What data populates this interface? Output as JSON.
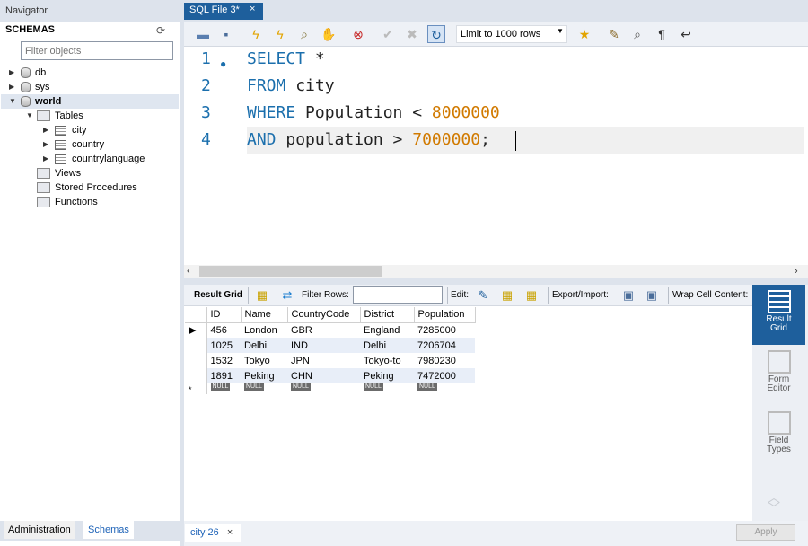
{
  "navigator": {
    "title": "Navigator",
    "schemas_header": "SCHEMAS",
    "filter_placeholder": "Filter objects",
    "schemas": [
      {
        "name": "db"
      },
      {
        "name": "sys"
      },
      {
        "name": "world"
      }
    ],
    "world_children": {
      "tables_label": "Tables",
      "tables": [
        "city",
        "country",
        "countrylanguage"
      ],
      "views_label": "Views",
      "procedures_label": "Stored Procedures",
      "functions_label": "Functions"
    },
    "bottom_tabs": {
      "administration": "Administration",
      "schemas": "Schemas"
    }
  },
  "editor_tab": {
    "label": "SQL File 3*",
    "close": "×"
  },
  "toolbar": {
    "limit_label": "Limit to 1000 rows",
    "icons": [
      "open-folder-icon",
      "save-icon",
      "execute-icon",
      "execute-current-icon",
      "explain-icon",
      "stop-icon",
      "toggle-error-icon",
      "commit-icon",
      "rollback-icon",
      "autocommit-icon",
      "bookmark-icon",
      "beautify-icon",
      "find-icon",
      "invisible-chars-icon",
      "wrap-icon"
    ]
  },
  "sql": {
    "line_numbers": [
      "1",
      "2",
      "3",
      "4"
    ],
    "lines": [
      {
        "kw": "SELECT",
        "rest": " *",
        "num": ""
      },
      {
        "kw": "FROM",
        "rest": " city",
        "num": ""
      },
      {
        "kw": "WHERE",
        "rest": " Population < ",
        "num": "8000000"
      },
      {
        "kw": "AND",
        "rest": " population > ",
        "num": "7000000",
        "tail": ";"
      }
    ]
  },
  "result_toolbar": {
    "result_grid": "Result Grid",
    "filter_rows": "Filter Rows:",
    "edit": "Edit:",
    "export_import": "Export/Import:",
    "wrap": "Wrap Cell Content:"
  },
  "result_table": {
    "columns": [
      "ID",
      "Name",
      "CountryCode",
      "District",
      "Population"
    ],
    "rows": [
      [
        "456",
        "London",
        "GBR",
        "England",
        "7285000"
      ],
      [
        "1025",
        "Delhi",
        "IND",
        "Delhi",
        "7206704"
      ],
      [
        "1532",
        "Tokyo",
        "JPN",
        "Tokyo-to",
        "7980230"
      ],
      [
        "1891",
        "Peking",
        "CHN",
        "Peking",
        "7472000"
      ]
    ],
    "null_label": "NULL",
    "new_row_marker": "*"
  },
  "side_panel": {
    "result_grid": "Result Grid",
    "form_editor": "Form Editor",
    "field_types": "Field Types"
  },
  "bottom": {
    "result_tab": "city 26",
    "close": "×",
    "apply": "Apply"
  },
  "colors": {
    "accent": "#1e5f9c",
    "keyword": "#1b6fad",
    "number": "#d17a00"
  }
}
